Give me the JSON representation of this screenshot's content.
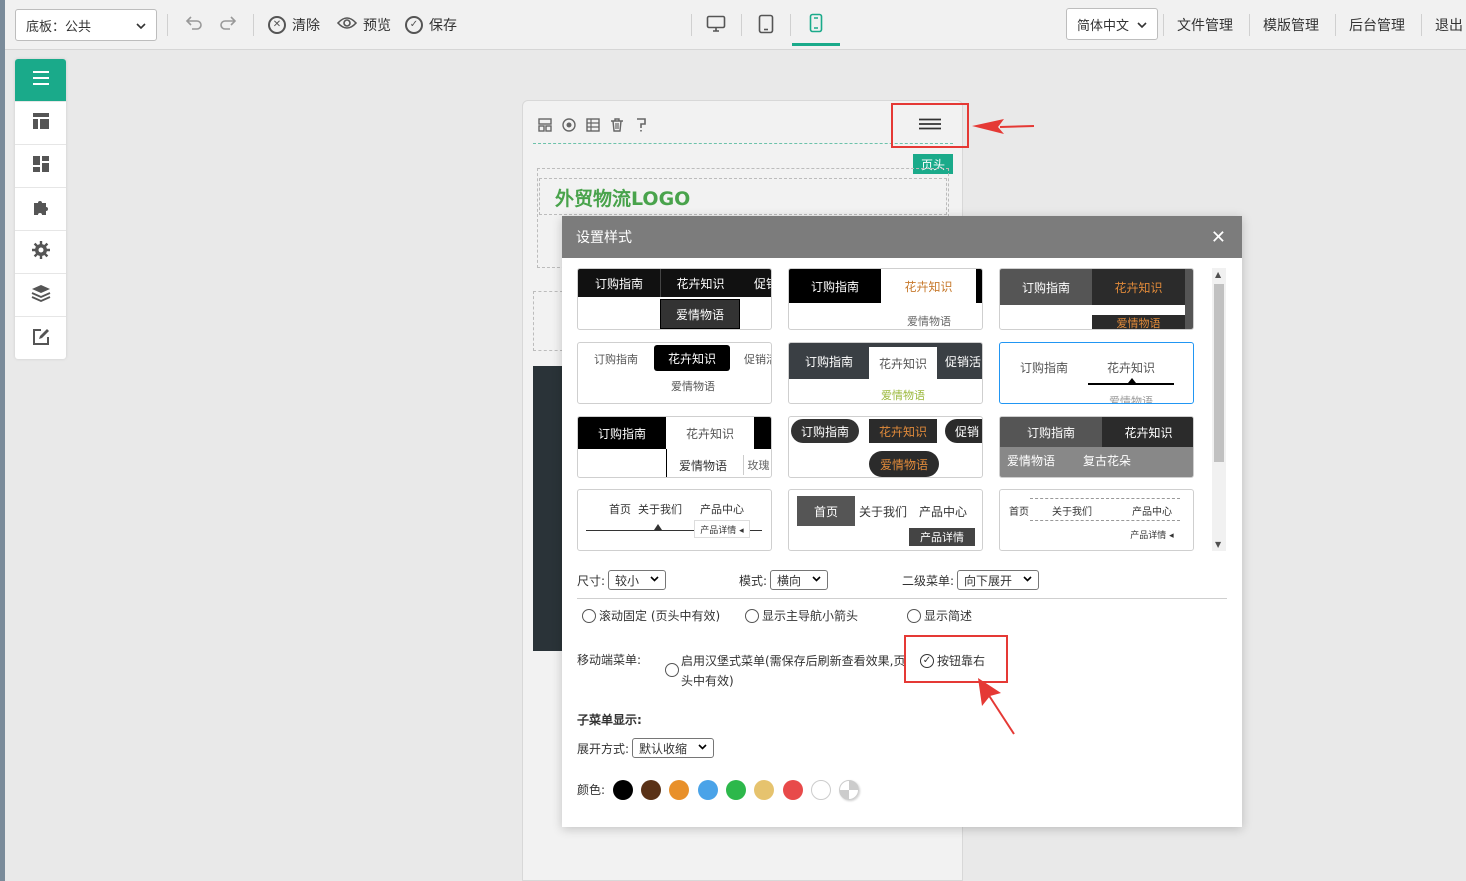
{
  "topbar": {
    "board_select": "底板：公共",
    "undo_icon": "undo-icon",
    "redo_icon": "redo-icon",
    "clear_label": "清除",
    "preview_label": "预览",
    "save_label": "保存",
    "devices": [
      "desktop-icon",
      "tablet-icon",
      "mobile-icon"
    ],
    "active_device": "mobile",
    "language": "简体中文",
    "links": [
      "文件管理",
      "模版管理",
      "后台管理",
      "退出"
    ],
    "accent_color": "#1aaa8a"
  },
  "sidebar": {
    "items": [
      "menu-icon",
      "layout-icon",
      "dashboard-icon",
      "puzzle-icon",
      "gear-icon",
      "layers-icon",
      "edit-icon"
    ]
  },
  "canvas": {
    "header_tag": "页头",
    "logo_text": "外贸物流LOGO"
  },
  "modal": {
    "title": "设置样式",
    "close_symbol": "✕",
    "styles": [
      {
        "texts": [
          "订购指南",
          "花卉知识",
          "促销",
          "爱情物语"
        ]
      },
      {
        "texts": [
          "订购指南",
          "花卉知识",
          "爱情物语"
        ]
      },
      {
        "texts": [
          "订购指南",
          "花卉知识",
          "爱情物语"
        ]
      },
      {
        "texts": [
          "订购指南",
          "花卉知识",
          "促销活",
          "爱情物语"
        ]
      },
      {
        "texts": [
          "订购指南",
          "花卉知识",
          "促销活",
          "爱情物语"
        ]
      },
      {
        "texts": [
          "订购指南",
          "花卉知识",
          "爱情物语"
        ]
      },
      {
        "texts": [
          "订购指南",
          "花卉知识",
          "爱情物语",
          "玫瑰"
        ]
      },
      {
        "texts": [
          "订购指南",
          "花卉知识",
          "促销",
          "爱情物语"
        ]
      },
      {
        "texts": [
          "订购指南",
          "花卉知识",
          "爱情物语",
          "复古花朵"
        ]
      },
      {
        "texts": [
          "首页",
          "关于我们",
          "产品中心",
          "产品详情 ◂"
        ]
      },
      {
        "texts": [
          "首页",
          "关于我们",
          "产品中心",
          "产品详情"
        ]
      },
      {
        "texts": [
          "首页",
          "关于我们",
          "产品中心",
          "产品详情 ◂"
        ]
      }
    ],
    "selected_style_index": 5,
    "size_label": "尺寸:",
    "size_value": "较小",
    "mode_label": "模式:",
    "mode_value": "横向",
    "submenu_label": "二级菜单:",
    "submenu_value": "向下展开",
    "option_scroll_fixed": "滚动固定 (页头中有效)",
    "option_show_arrow": "显示主导航小箭头",
    "option_show_desc": "显示简述",
    "mobile_menu_label": "移动端菜单:",
    "hamburger_option_line1": "启用汉堡式菜单(需保存后刷新查看效果,页",
    "hamburger_option_line2": "头中有效)",
    "button_right_label": "按钮靠右",
    "button_right_checked": true,
    "submenu_display_label": "子菜单显示:",
    "expand_label": "展开方式:",
    "expand_value": "默认收缩",
    "color_label": "颜色:",
    "colors": [
      "#000000",
      "#5a3217",
      "#e8902a",
      "#4aa3e8",
      "#2db84b",
      "#e6c36e",
      "#e84a4a",
      "#ffffff",
      "checker"
    ]
  }
}
